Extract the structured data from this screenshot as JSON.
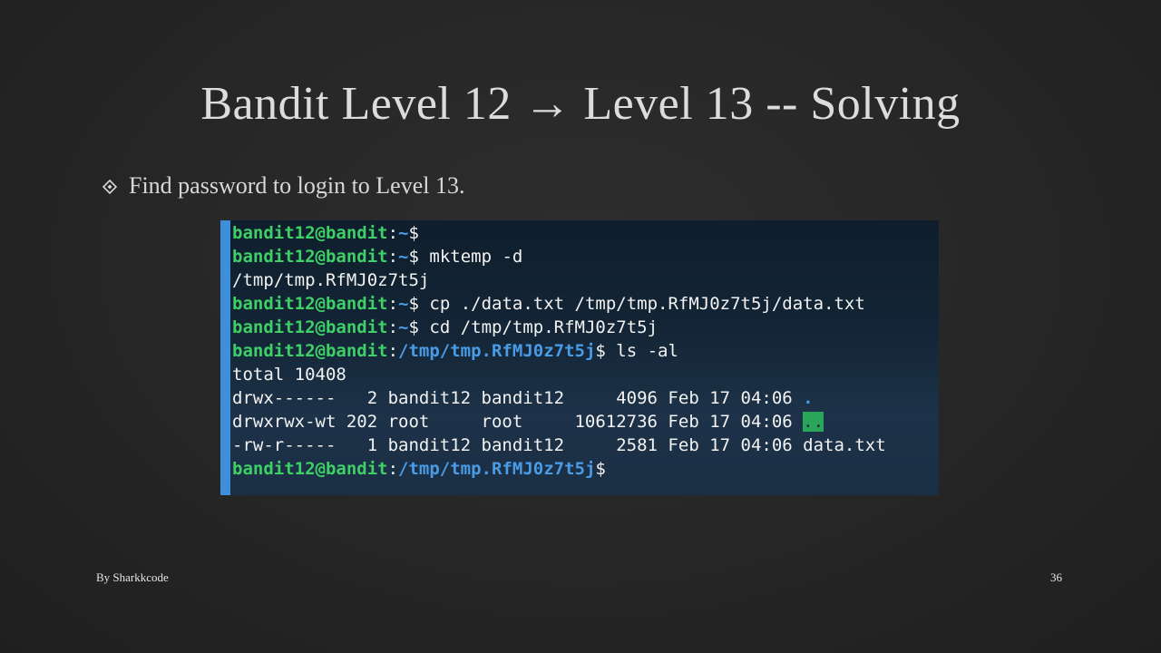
{
  "slide": {
    "title": "Bandit Level 12 → Level 13 -- Solving",
    "bullet": "Find password to login to Level 13.",
    "bullet_icon": "diamond-bullet-icon",
    "footer_author": "By Sharkkcode",
    "page_number": "36"
  },
  "terminal": {
    "colors": {
      "background": "#132536",
      "edge": "#3c8fd8",
      "user": "#3ecf67",
      "path": "#4a9be6",
      "text": "#f2f2f2"
    },
    "lines": [
      [
        {
          "t": "bandit12@bandit",
          "c": "g"
        },
        {
          "t": ":",
          "c": "w"
        },
        {
          "t": "~",
          "c": "b"
        },
        {
          "t": "$",
          "c": "w"
        }
      ],
      [
        {
          "t": "bandit12@bandit",
          "c": "g"
        },
        {
          "t": ":",
          "c": "w"
        },
        {
          "t": "~",
          "c": "b"
        },
        {
          "t": "$ mktemp -d",
          "c": "w"
        }
      ],
      [
        {
          "t": "/tmp/tmp.RfMJ0z7t5j",
          "c": "w"
        }
      ],
      [
        {
          "t": "bandit12@bandit",
          "c": "g"
        },
        {
          "t": ":",
          "c": "w"
        },
        {
          "t": "~",
          "c": "b"
        },
        {
          "t": "$ cp ./data.txt /tmp/tmp.RfMJ0z7t5j/data.txt",
          "c": "w"
        }
      ],
      [
        {
          "t": "bandit12@bandit",
          "c": "g"
        },
        {
          "t": ":",
          "c": "w"
        },
        {
          "t": "~",
          "c": "b"
        },
        {
          "t": "$ cd /tmp/tmp.RfMJ0z7t5j",
          "c": "w"
        }
      ],
      [
        {
          "t": "bandit12@bandit",
          "c": "g"
        },
        {
          "t": ":",
          "c": "w"
        },
        {
          "t": "/tmp/tmp.RfMJ0z7t5j",
          "c": "b"
        },
        {
          "t": "$ ls -al",
          "c": "w"
        }
      ],
      [
        {
          "t": "total 10408",
          "c": "w"
        }
      ],
      [
        {
          "t": "drwx------   2 bandit12 bandit12     4096 Feb 17 04:06 ",
          "c": "w"
        },
        {
          "t": ".",
          "c": "dot"
        }
      ],
      [
        {
          "t": "drwxrwx-wt 202 root     root     10612736 Feb 17 04:06 ",
          "c": "w"
        },
        {
          "t": "..",
          "c": "dotdot"
        }
      ],
      [
        {
          "t": "-rw-r-----   1 bandit12 bandit12     2581 Feb 17 04:06 data.txt",
          "c": "w"
        }
      ],
      [
        {
          "t": "bandit12@bandit",
          "c": "g"
        },
        {
          "t": ":",
          "c": "w"
        },
        {
          "t": "/tmp/tmp.RfMJ0z7t5j",
          "c": "b"
        },
        {
          "t": "$",
          "c": "w"
        }
      ]
    ]
  }
}
